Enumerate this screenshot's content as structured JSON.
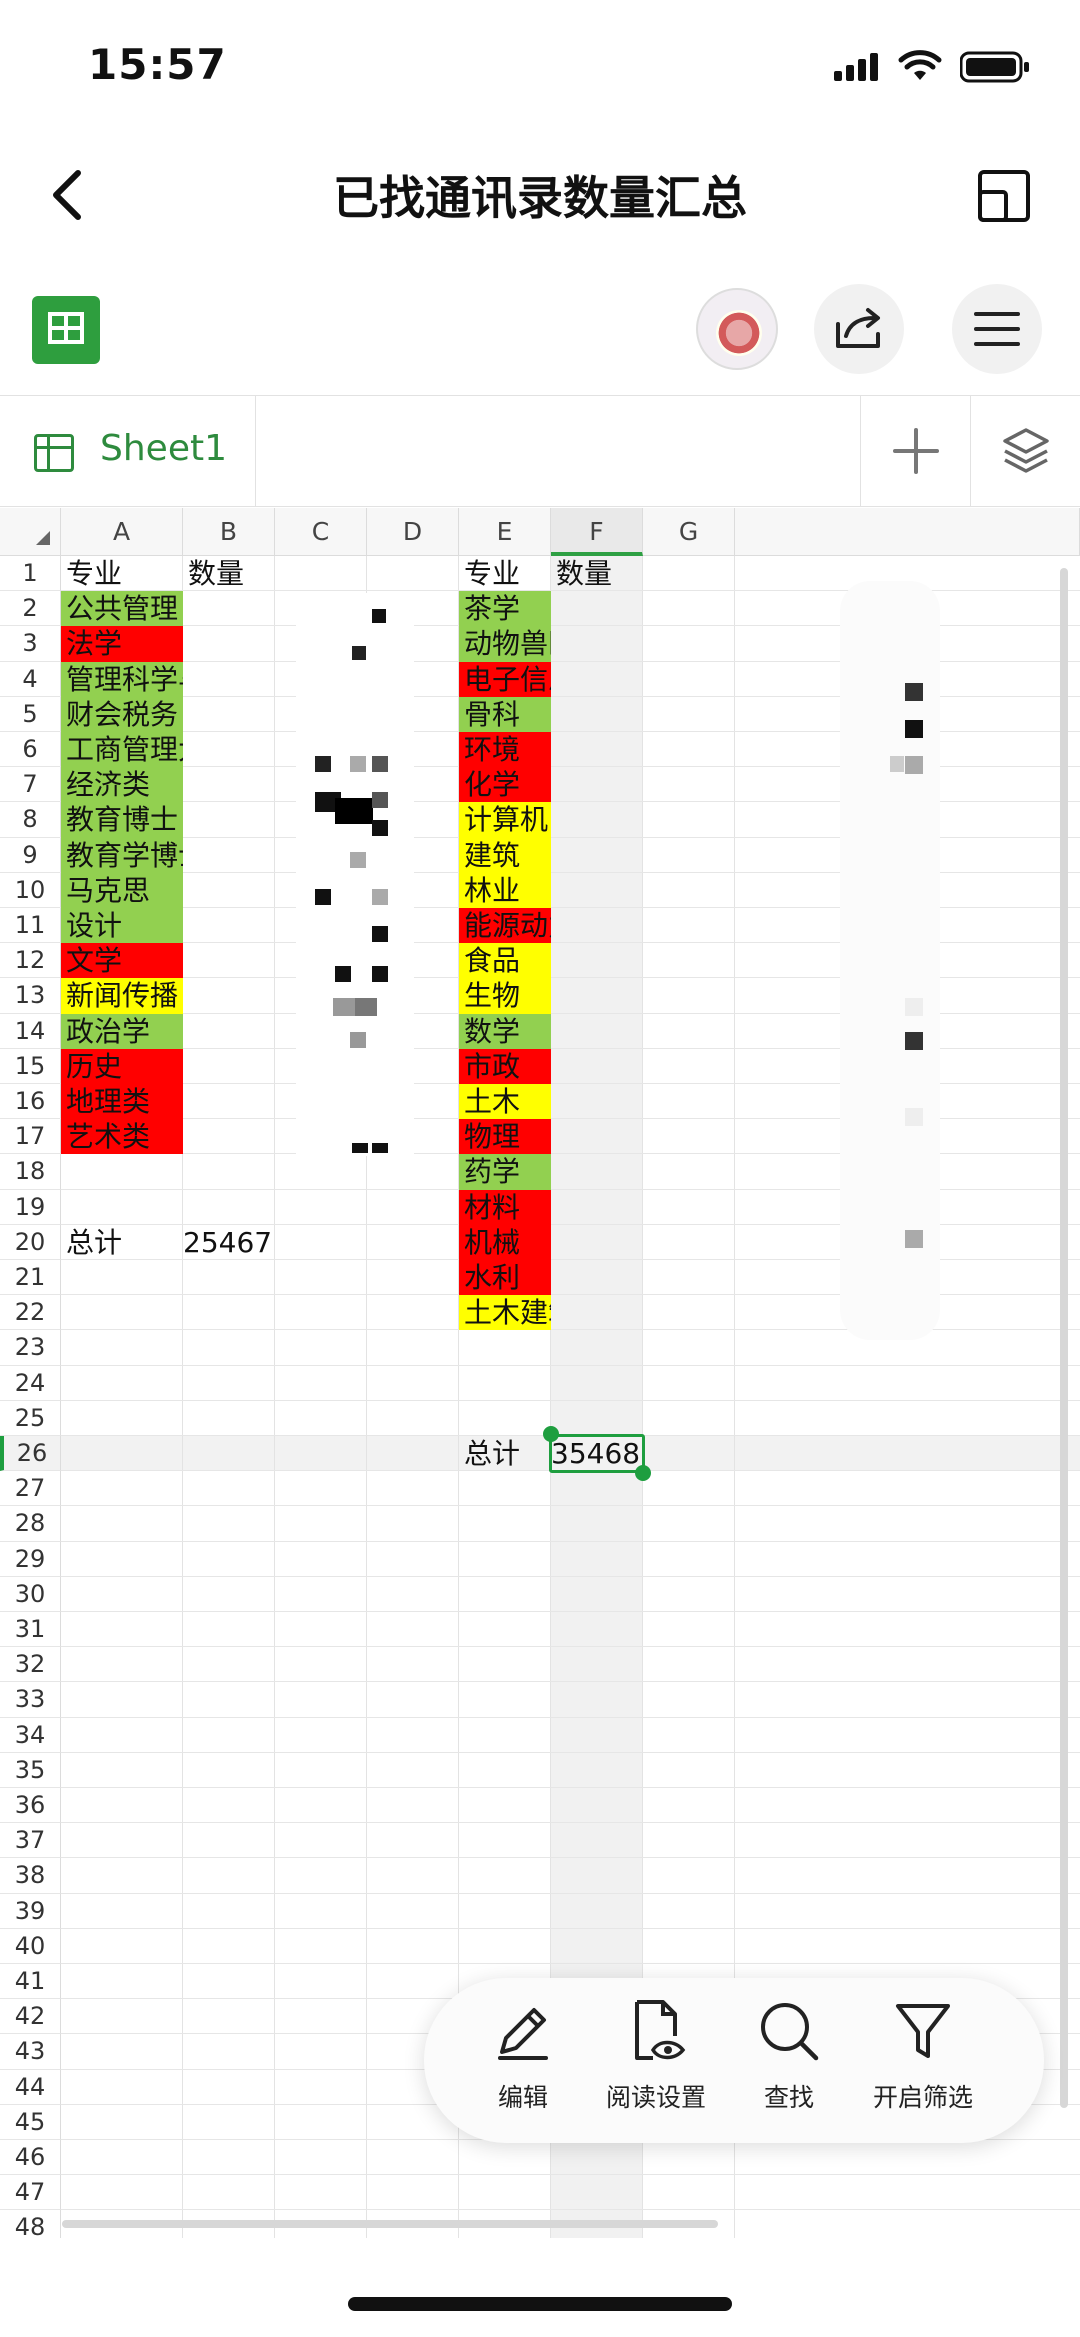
{
  "status_bar": {
    "time": "15:57"
  },
  "header": {
    "title": "已找通讯录数量汇总"
  },
  "sheet_tab": {
    "name": "Sheet1"
  },
  "columns": [
    "A",
    "B",
    "C",
    "D",
    "E",
    "F",
    "G"
  ],
  "rows": [
    "1",
    "2",
    "3",
    "4",
    "5",
    "6",
    "7",
    "8",
    "9",
    "10",
    "11",
    "12",
    "13",
    "14",
    "15",
    "16",
    "17",
    "18",
    "19",
    "20",
    "21",
    "22",
    "23",
    "24",
    "25",
    "26",
    "27",
    "28",
    "29",
    "30",
    "31",
    "32",
    "33",
    "34",
    "35",
    "36",
    "37",
    "38",
    "39",
    "40",
    "41",
    "42",
    "43",
    "44",
    "45",
    "46",
    "47",
    "48"
  ],
  "table_left": {
    "header_major": "专业",
    "header_count": "数量",
    "items": [
      {
        "name": "公共管理",
        "color": "#92d050"
      },
      {
        "name": "法学",
        "color": "#ff0000"
      },
      {
        "name": "管理科学与工程",
        "color": "#92d050"
      },
      {
        "name": "财会税务",
        "color": "#92d050"
      },
      {
        "name": "工商管理大类",
        "color": "#92d050"
      },
      {
        "name": "经济类",
        "color": "#92d050"
      },
      {
        "name": "教育博士",
        "color": "#92d050"
      },
      {
        "name": "教育学博士",
        "color": "#92d050"
      },
      {
        "name": "马克思",
        "color": "#92d050"
      },
      {
        "name": "设计",
        "color": "#92d050"
      },
      {
        "name": "文学",
        "color": "#ff0000"
      },
      {
        "name": "新闻传播",
        "color": "#ffff00"
      },
      {
        "name": "政治学",
        "color": "#92d050"
      },
      {
        "name": "历史",
        "color": "#ff0000"
      },
      {
        "name": "地理类",
        "color": "#ff0000"
      },
      {
        "name": "艺术类",
        "color": "#ff0000"
      }
    ],
    "total_label": "总计",
    "total_value": "25467"
  },
  "table_right": {
    "header_major": "专业",
    "header_count": "数量",
    "items": [
      {
        "name": "茶学",
        "color": "#92d050"
      },
      {
        "name": "动物兽医",
        "color": "#92d050"
      },
      {
        "name": "电子信息",
        "color": "#ff0000"
      },
      {
        "name": "骨科",
        "color": "#92d050"
      },
      {
        "name": "环境",
        "color": "#ff0000"
      },
      {
        "name": "化学",
        "color": "#ff0000"
      },
      {
        "name": "计算机",
        "color": "#ffff00"
      },
      {
        "name": "建筑",
        "color": "#ffff00"
      },
      {
        "name": "林业",
        "color": "#ffff00"
      },
      {
        "name": "能源动力",
        "color": "#ff0000"
      },
      {
        "name": "食品",
        "color": "#ffff00"
      },
      {
        "name": "生物",
        "color": "#ffff00"
      },
      {
        "name": "数学",
        "color": "#92d050"
      },
      {
        "name": "市政",
        "color": "#ff0000"
      },
      {
        "name": "土木",
        "color": "#ffff00"
      },
      {
        "name": "物理",
        "color": "#ff0000"
      },
      {
        "name": "药学",
        "color": "#92d050"
      },
      {
        "name": "材料",
        "color": "#ff0000"
      },
      {
        "name": "机械",
        "color": "#ff0000"
      },
      {
        "name": "水利",
        "color": "#ff0000"
      },
      {
        "name": "土木建筑",
        "color": "#ffff00"
      }
    ],
    "total_label": "总计",
    "total_value": "35468"
  },
  "bottom_actions": {
    "edit": "编辑",
    "read_settings": "阅读设置",
    "find": "查找",
    "filter": "开启筛选"
  },
  "colors": {
    "accent": "#1e9e3f",
    "sheet_green": "#2e8b3e"
  }
}
